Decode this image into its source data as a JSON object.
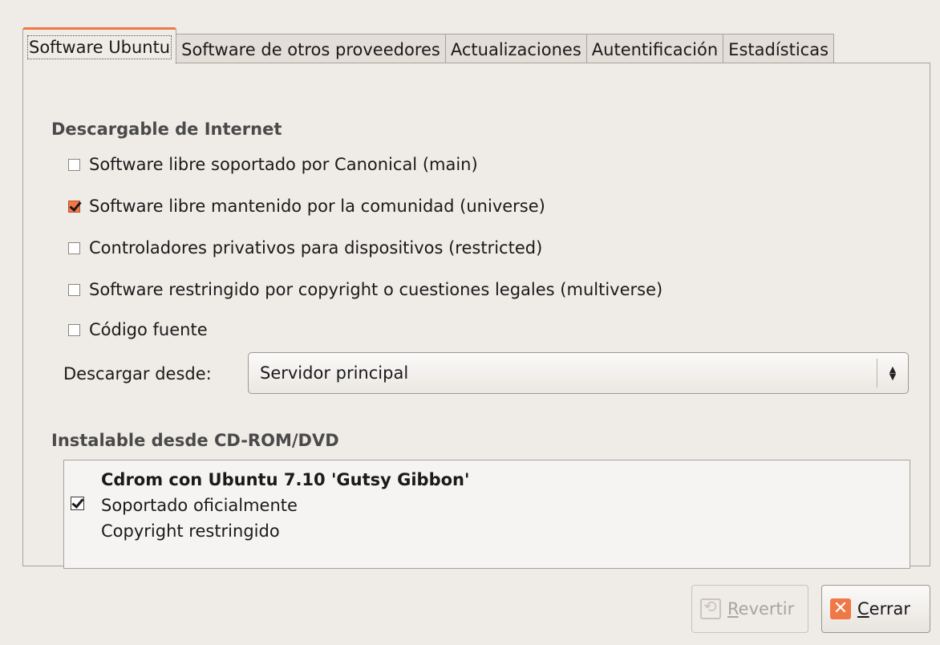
{
  "tabs": [
    {
      "label": "Software Ubuntu",
      "active": true
    },
    {
      "label": "Software de otros proveedores"
    },
    {
      "label": "Actualizaciones"
    },
    {
      "label": "Autentificación"
    },
    {
      "label": "Estadísticas"
    }
  ],
  "internet_section": {
    "title": "Descargable de Internet",
    "options": [
      {
        "label": "Software libre soportado por Canonical (main)",
        "checked": false
      },
      {
        "label": "Software libre mantenido por la comunidad (universe)",
        "checked": true
      },
      {
        "label": "Controladores privativos para dispositivos (restricted)",
        "checked": false
      },
      {
        "label": "Software restringido por copyright o cuestiones legales (multiverse)",
        "checked": false
      },
      {
        "label": "Código fuente",
        "checked": false
      }
    ],
    "download_from_label": "Descargar desde:",
    "download_from_value": "Servidor principal"
  },
  "cdrom_section": {
    "title": "Instalable desde CD-ROM/DVD",
    "entry": {
      "title": "Cdrom con Ubuntu 7.10 'Gutsy Gibbon'",
      "line1": "Soportado oficialmente",
      "line2": "Copyright restringido",
      "checked": true
    }
  },
  "buttons": {
    "revert_rest": "evertir",
    "revert_mnemonic": "R",
    "close_rest": "errar",
    "close_mnemonic": "C"
  },
  "colors": {
    "accent": "#f07746",
    "background": "#efebe7"
  }
}
